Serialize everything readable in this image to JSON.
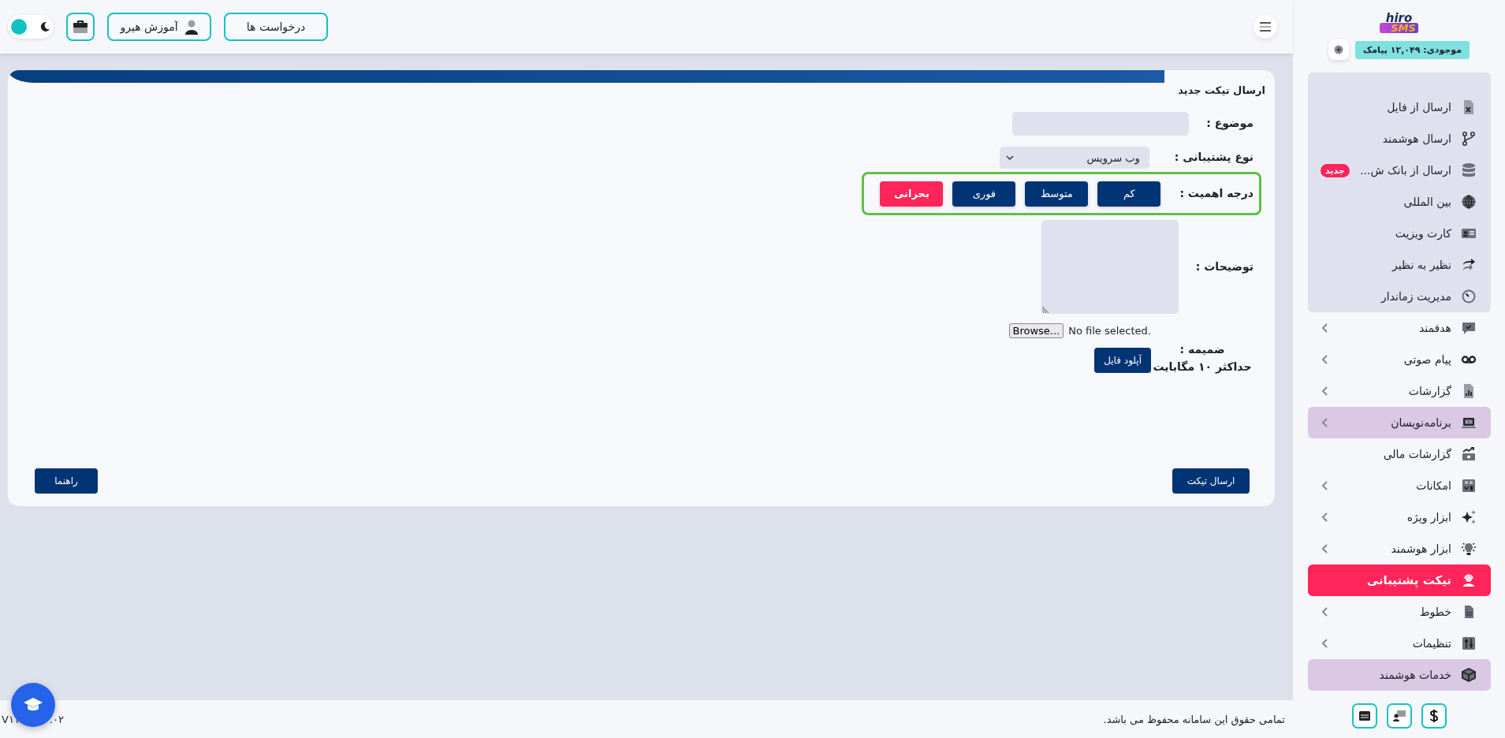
{
  "header": {
    "requests_button": "درخواست ها",
    "tutorial_button": "آموزش هیرو",
    "dark_mode": false
  },
  "sidebar": {
    "logo": {
      "top": "hiro",
      "bottom": "SMS"
    },
    "balance": "موجودی: ۱۲,۰۴۹ پیامک",
    "submenu": [
      {
        "label": "ارسال از فایل"
      },
      {
        "label": "ارسال هوشمند"
      },
      {
        "label": "ارسال از بانک ش...",
        "badge": "جدید"
      },
      {
        "label": "بین المللی"
      },
      {
        "label": "کارت ویزیت"
      },
      {
        "label": "نظیر به نظیر"
      },
      {
        "label": "مدیریت زماندار"
      }
    ],
    "items": [
      {
        "label": "هدفمند",
        "has_submenu": true,
        "selected": false,
        "highlighted": false
      },
      {
        "label": "پیام صوتی",
        "has_submenu": true,
        "selected": false,
        "highlighted": false
      },
      {
        "label": "گزارشات",
        "has_submenu": true,
        "selected": false,
        "highlighted": false
      },
      {
        "label": "برنامه‌نویسان",
        "has_submenu": true,
        "selected": false,
        "highlighted": true
      },
      {
        "label": "گزارشات مالی",
        "has_submenu": false,
        "selected": false,
        "highlighted": false
      },
      {
        "label": "امکانات",
        "has_submenu": true,
        "selected": false,
        "highlighted": false
      },
      {
        "label": "ابزار ویژه",
        "has_submenu": true,
        "selected": false,
        "highlighted": false
      },
      {
        "label": "ابزار هوشمند",
        "has_submenu": true,
        "selected": false,
        "highlighted": false
      },
      {
        "label": "تیکت پشتیبانی",
        "has_submenu": false,
        "selected": true,
        "highlighted": false
      },
      {
        "label": "خطوط",
        "has_submenu": true,
        "selected": false,
        "highlighted": false
      },
      {
        "label": "تنظیمات",
        "has_submenu": true,
        "selected": false,
        "highlighted": false
      },
      {
        "label": "خدمات هوشمند",
        "has_submenu": false,
        "selected": false,
        "highlighted": true
      }
    ]
  },
  "ticket_form": {
    "title": "ارسال تیکت جدید",
    "fields": [
      {
        "kind": "text",
        "label": "موضوع :"
      },
      {
        "kind": "select",
        "label": "نوع پشتیبانی :",
        "value": "وب سرویس"
      },
      {
        "kind": "priority",
        "label": "درجه اهمیت :",
        "options": [
          {
            "label": "کم",
            "selected": false
          },
          {
            "label": "متوسط",
            "selected": false
          },
          {
            "label": "فوری",
            "selected": false
          },
          {
            "label": "بحرانی",
            "selected": true
          }
        ]
      },
      {
        "kind": "textarea",
        "label": "توضیحات :"
      },
      {
        "kind": "attachment",
        "label": "ضمیمه :",
        "hint": "حداکثر ۱۰ مگابایت",
        "file_status": "No file selected.",
        "browse_button": "Browse...",
        "upload_button": "آپلود فایل"
      }
    ],
    "submit_button": "ارسال تیکت",
    "help_button": "راهنما"
  },
  "footer": {
    "copyright": "تمامی حقوق این سامانه محفوظ می باشد.",
    "version_start": "V۱۱",
    "version_end": ".۰۲"
  }
}
